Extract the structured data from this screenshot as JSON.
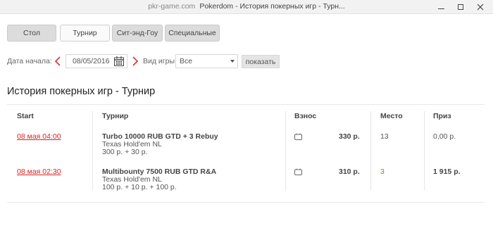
{
  "window": {
    "domain": "pkr-game.com",
    "title": "Pokerdom - История покерных игр - Турн..."
  },
  "tabs": [
    {
      "label": "Стол",
      "active": false
    },
    {
      "label": "Турнир",
      "active": true
    },
    {
      "label": "Сит-энд-Гоу",
      "active": false
    },
    {
      "label": "Специальные",
      "active": false
    }
  ],
  "filters": {
    "date_label": "Дата начала:",
    "date_value": "08/05/2016",
    "game_label": "Вид игры:",
    "game_value": "Все",
    "show_button": "показать"
  },
  "heading": "История покерных игр - Турнир",
  "table": {
    "columns": [
      "Start",
      "Турнир",
      "Взнос",
      "Место",
      "Приз"
    ],
    "rows": [
      {
        "start": "08 мая 04:00",
        "name": "Turbo 10000 RUB GTD + 3 Rebuy",
        "game": "Texas Hold'em NL",
        "buyin_detail": "300 р. + 30 р.",
        "fee": "330 р.",
        "place": "13",
        "prize": "0,00 р."
      },
      {
        "start": "08 мая 02:30",
        "name": "Multibounty 7500 RUB GTD R&A",
        "game": "Texas Hold'em NL",
        "buyin_detail": "100 р. + 10 р. + 100 р.",
        "fee": "310 р.",
        "place": "3",
        "prize": "1 915 р."
      }
    ]
  },
  "colors": {
    "accent_red": "#d22222",
    "place_highlight": "#a07a1e"
  }
}
